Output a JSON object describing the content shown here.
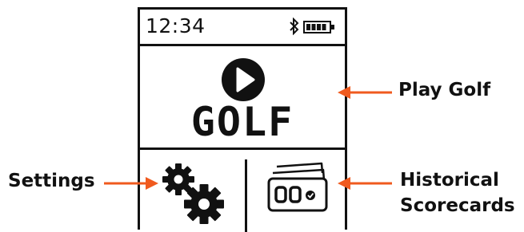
{
  "device": {
    "time": "12:34",
    "bluetooth_icon": "bluetooth-icon",
    "battery_icon": "battery-full-icon",
    "main_button_label": "GOLF",
    "main_button_icon": "play-icon",
    "settings_icon": "gears-icon",
    "scorecards_icon": "scorecards-icon"
  },
  "callouts": {
    "play": "Play Golf",
    "settings": "Settings",
    "historical_line1": "Historical",
    "historical_line2": "Scorecards"
  },
  "colors": {
    "arrow": "#F05A1E",
    "ink": "#111111"
  }
}
